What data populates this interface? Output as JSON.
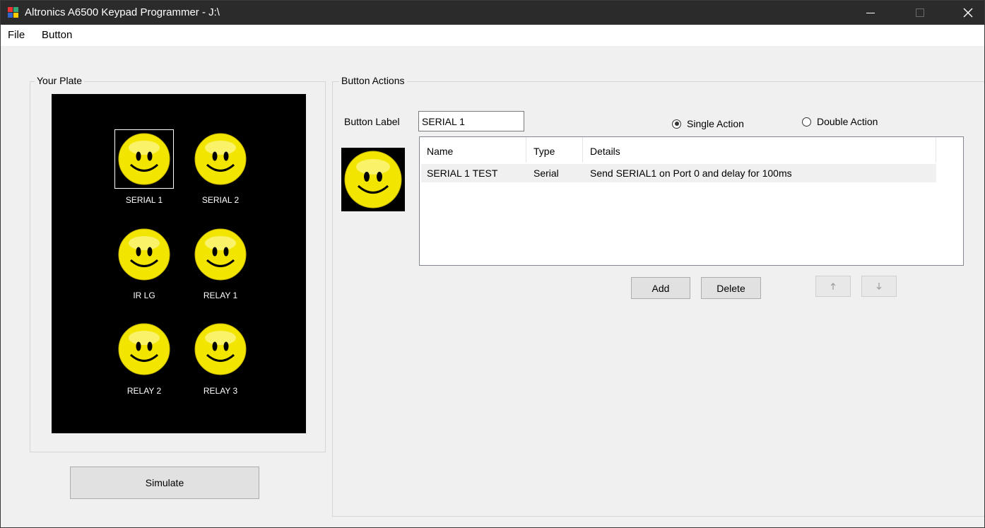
{
  "window": {
    "title": "Altronics A6500 Keypad Programmer - J:\\",
    "minimize_icon": "minimize-icon",
    "maximize_icon": "maximize-icon",
    "close_icon": "close-icon"
  },
  "menu": {
    "items": [
      "File",
      "Button"
    ]
  },
  "plate": {
    "title": "Your Plate",
    "buttons": [
      {
        "label": "SERIAL 1",
        "selected": true
      },
      {
        "label": "SERIAL 2",
        "selected": false
      },
      {
        "label": "IR LG",
        "selected": false
      },
      {
        "label": "RELAY 1",
        "selected": false
      },
      {
        "label": "RELAY 2",
        "selected": false
      },
      {
        "label": "RELAY 3",
        "selected": false
      }
    ],
    "simulate_label": "Simulate"
  },
  "actions": {
    "title": "Button Actions",
    "button_label_caption": "Button Label",
    "button_label_value": "SERIAL 1",
    "single_action_label": "Single Action",
    "double_action_label": "Double Action",
    "single_action_checked": true,
    "columns": [
      "Name",
      "Type",
      "Details"
    ],
    "rows": [
      {
        "name": "SERIAL 1 TEST",
        "type": "Serial",
        "details": "Send SERIAL1 on Port 0 and delay for 100ms"
      }
    ],
    "add_label": "Add",
    "delete_label": "Delete",
    "up_icon": "arrow-up-icon",
    "down_icon": "arrow-down-icon"
  },
  "colors": {
    "titlebar": "#2b2b2b",
    "face_yellow": "#f2e500",
    "plate_bg": "#000000"
  }
}
